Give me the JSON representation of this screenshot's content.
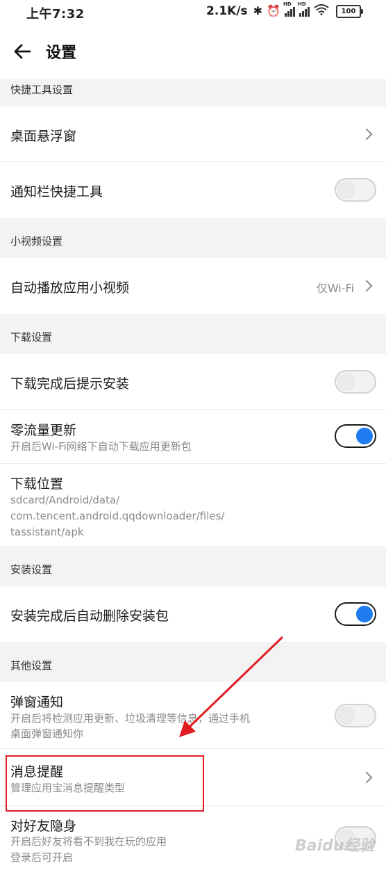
{
  "status_bar": {
    "time": "上午7:32",
    "network_speed": "2.1K/s",
    "battery": "100"
  },
  "header": {
    "title": "设置"
  },
  "sections": {
    "quick_tools": {
      "title": "快捷工具设置",
      "desktop_float": {
        "label": "桌面悬浮窗"
      },
      "notif_tools": {
        "label": "通知栏快捷工具",
        "enabled": false
      }
    },
    "video": {
      "title": "小视频设置",
      "autoplay": {
        "label": "自动播放应用小视频",
        "value": "仅Wi-Fi"
      }
    },
    "download": {
      "title": "下载设置",
      "prompt_install": {
        "label": "下载完成后提示安装",
        "enabled": false
      },
      "zero_traffic": {
        "label": "零流量更新",
        "desc": "开启后Wi-Fi网络下自动下载应用更新包",
        "enabled": true
      },
      "location": {
        "label": "下载位置",
        "path_line1": "sdcard/Android/data/",
        "path_line2": "com.tencent.android.qqdownloader/files/",
        "path_line3": "tassistant/apk"
      }
    },
    "install": {
      "title": "安装设置",
      "auto_delete": {
        "label": "安装完成后自动删除安装包",
        "enabled": true
      }
    },
    "other": {
      "title": "其他设置",
      "popup": {
        "label": "弹窗通知",
        "desc_line1": "开启后将检测应用更新、垃圾清理等信息，通过手机",
        "desc_line2": "桌面弹窗通知你",
        "enabled": false
      },
      "message": {
        "label": "消息提醒",
        "desc": "管理应用宝消息提醒类型"
      },
      "invisible": {
        "label": "对好友隐身",
        "desc_line1": "开启后好友将看不到我在玩的应用",
        "desc_line2": "登录后可开启",
        "enabled": false
      }
    }
  },
  "watermark": {
    "text": "Baidu经验"
  },
  "colors": {
    "accent": "#1e7cf0",
    "annotation": "#e11b22"
  }
}
